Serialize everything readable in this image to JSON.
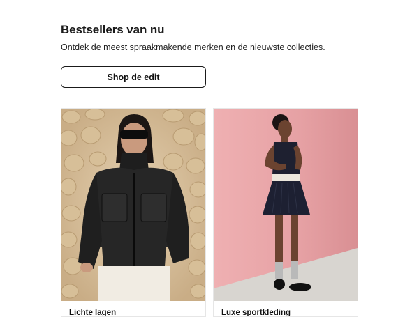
{
  "header": {
    "title": "Bestsellers van nu",
    "subtitle": "Ontdek de meest spraakmakende merken en de nieuwste collecties.",
    "cta_label": "Shop de edit"
  },
  "cards": [
    {
      "label": "Lichte lagen",
      "image": "woman-in-black-leather-jacket-photo"
    },
    {
      "label": "Luxe sportkleding",
      "image": "woman-in-sporty-dress-photo"
    }
  ],
  "colors": {
    "text": "#1a1a1a",
    "card_border": "#e6e6e6",
    "pink_wall": "#e8a9ab",
    "stone_wall": "#d9c3a2"
  }
}
